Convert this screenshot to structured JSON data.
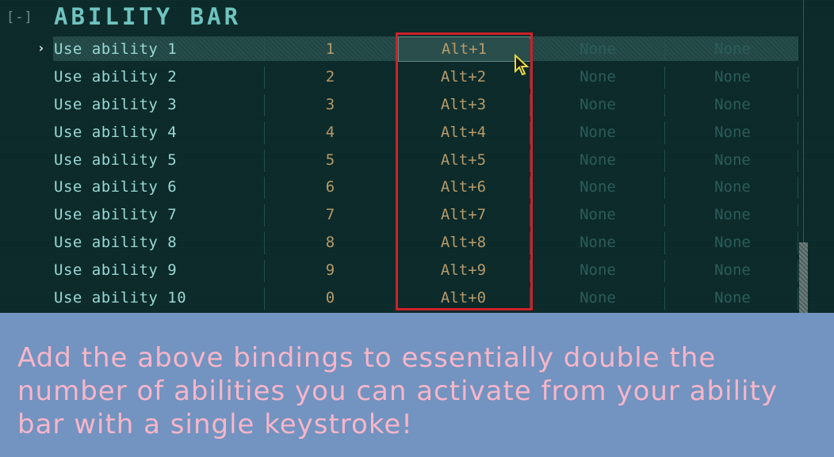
{
  "section": {
    "toggle": "[-]",
    "title": "ABILITY BAR"
  },
  "selected_marker": "›",
  "rows": [
    {
      "action": "Use ability 1",
      "key1": "1",
      "key2": "Alt+1",
      "key3": "None",
      "key4": "None"
    },
    {
      "action": "Use ability 2",
      "key1": "2",
      "key2": "Alt+2",
      "key3": "None",
      "key4": "None"
    },
    {
      "action": "Use ability 3",
      "key1": "3",
      "key2": "Alt+3",
      "key3": "None",
      "key4": "None"
    },
    {
      "action": "Use ability 4",
      "key1": "4",
      "key2": "Alt+4",
      "key3": "None",
      "key4": "None"
    },
    {
      "action": "Use ability 5",
      "key1": "5",
      "key2": "Alt+5",
      "key3": "None",
      "key4": "None"
    },
    {
      "action": "Use ability 6",
      "key1": "6",
      "key2": "Alt+6",
      "key3": "None",
      "key4": "None"
    },
    {
      "action": "Use ability 7",
      "key1": "7",
      "key2": "Alt+7",
      "key3": "None",
      "key4": "None"
    },
    {
      "action": "Use ability 8",
      "key1": "8",
      "key2": "Alt+8",
      "key3": "None",
      "key4": "None"
    },
    {
      "action": "Use ability 9",
      "key1": "9",
      "key2": "Alt+9",
      "key3": "None",
      "key4": "None"
    },
    {
      "action": "Use ability 10",
      "key1": "0",
      "key2": "Alt+0",
      "key3": "None",
      "key4": "None"
    }
  ],
  "banner": {
    "text": "Add the above bindings to essentially double the number of abilities you can activate from your ability bar with a single keystroke!"
  },
  "colors": {
    "highlight": "#d0202a",
    "banner_bg": "#7393c0",
    "banner_text": "#f6b6c9"
  }
}
